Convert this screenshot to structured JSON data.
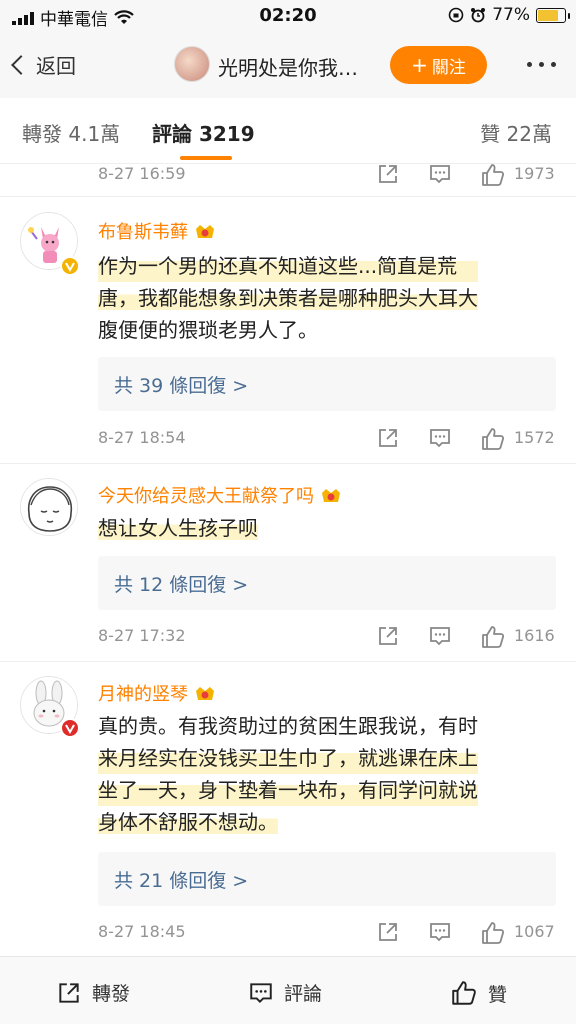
{
  "status_bar": {
    "carrier": "中華電信",
    "time": "02:20",
    "battery": "77%",
    "battery_level": 0.77
  },
  "nav": {
    "back_label": "返回",
    "title": "光明处是你我…",
    "follow_label": "關注"
  },
  "tabs": {
    "repost": "轉發 4.1萬",
    "comments": "評論 3219",
    "likes": "贊 22萬"
  },
  "top_meta": {
    "date": "8-27 16:59",
    "likes": "1973"
  },
  "comments": [
    {
      "username": "布鲁斯韦藓",
      "lines": [
        "作为一个男的还真不知道这些...简直是荒",
        "唐，我都能想象到决策者是哪种肥头大耳大",
        "腹便便的猥琐老男人了。"
      ],
      "replies": "共 39 條回復 >",
      "date": "8-27 18:54",
      "likes": "1572",
      "badge_color": "#f5b301"
    },
    {
      "username": "今天你给灵感大王献祭了吗",
      "lines": [
        "想让女人生孩子呗"
      ],
      "replies": "共 12 條回復 >",
      "date": "8-27 17:32",
      "likes": "1616"
    },
    {
      "username": "月神的竖琴",
      "lines": [
        "真的贵。有我资助过的贫困生跟我说，有时",
        "来月经实在没钱买卫生巾了，就逃课在床上",
        "坐了一天，身下垫着一块布，有同学问就说",
        "身体不舒服不想动。"
      ],
      "replies": "共 21 條回復 >",
      "date": "8-27 18:45",
      "likes": "1067",
      "badge_color": "#e02b2b"
    }
  ],
  "toolbar": {
    "repost": "轉發",
    "comment": "評論",
    "like": "贊"
  },
  "colors": {
    "accent": "#ff8200",
    "link": "#4a6c93",
    "meta": "#939393"
  }
}
